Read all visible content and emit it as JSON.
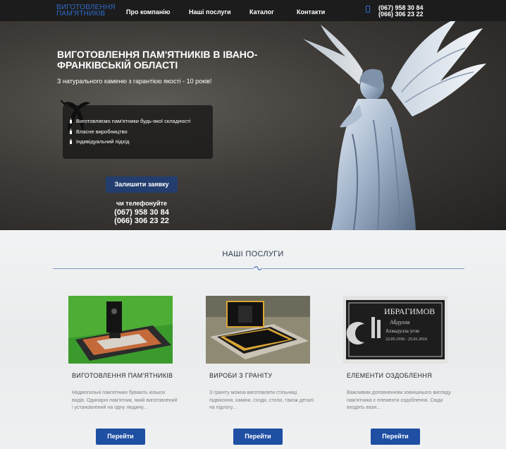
{
  "header": {
    "logo_line1": "ВИГОТОВЛЕННЯ",
    "logo_line2": "ПАМ'ЯТНИКІВ",
    "nav": [
      "Про компанію",
      "Наші послуги",
      "Каталог",
      "Контакти"
    ],
    "phone1": "(067) 958 30 84",
    "phone2": "(066) 306 23 22"
  },
  "hero": {
    "title": "ВИГОТОВЛЕННЯ ПАМ'ЯТНИКІВ В ІВАНО-ФРАНКІВСЬКІЙ ОБЛАСТІ",
    "subtitle": "З натурального каменю з гарантією якості - 10 років!",
    "features": [
      "Виготовляємо пам'ятники будь-якої складності",
      "Власне виробництво",
      "Індивідуальний підхід"
    ],
    "request_button": "Залишити заявку",
    "call_label": "чи телефонуйте",
    "phone1": "(067) 958 30 84",
    "phone2": "(066) 306 23 22"
  },
  "services": {
    "title": "НАШІ ПОСЛУГИ",
    "cards": [
      {
        "title": "ВИГОТОВЛЕННЯ ПАМ'ЯТНИКІВ",
        "text": "Надмогильні пам'ятники бувають кількох видів. Одинарні пам'ятник, який виготовлений і установлений на одну людину...",
        "button": "Перейти"
      },
      {
        "title": "ВИРОБИ З ГРАНІТУ",
        "text": "З граніту можна виготовляти стільниці, підвіконня, каміни, сходи, столи, також деталі на підлогу...",
        "button": "Перейти"
      },
      {
        "title": "ЕЛЕМЕНТИ ОЗДОБЛЕННЯ",
        "text": "Важливим доповненням зовнішнього вигляду пам'ятника є елементи оздоблення. Сюди входять вази...",
        "button": "Перейти"
      }
    ],
    "plaque": {
      "name": "ИБРАГИМОВ",
      "line2": "Абдулла",
      "line3": "Ахмадулла угли",
      "dates": "22.05.1936 - 25.01.2010"
    }
  },
  "colors": {
    "accent": "#1f4fa3",
    "dark_button": "#233e6e",
    "header_bg": "#1c1c1c",
    "logo": "#2f6bc8"
  }
}
